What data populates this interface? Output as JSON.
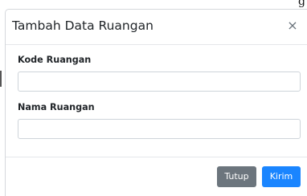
{
  "modal": {
    "title": "Tambah Data Ruangan",
    "close_symbol": "×"
  },
  "form": {
    "kode_label": "Kode Ruangan",
    "kode_value": "",
    "nama_label": "Nama Ruangan",
    "nama_value": ""
  },
  "footer": {
    "tutup_label": "Tutup",
    "kirim_label": "Kirim"
  },
  "background": {
    "corner_glyph": "g"
  },
  "colors": {
    "primary": "#1a85ff",
    "secondary": "#6c757d"
  }
}
